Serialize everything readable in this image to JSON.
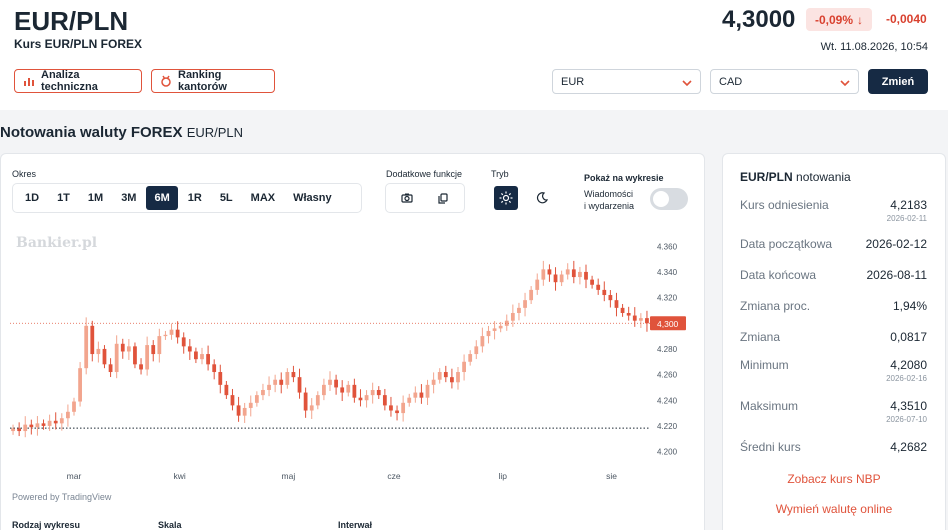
{
  "header": {
    "title": "EUR/PLN",
    "subtitle": "Kurs EUR/PLN FOREX",
    "price": "4,3000",
    "change_pct": "-0,09%",
    "change_abs": "-0,0040",
    "timestamp": "Wt. 11.08.2026, 10:54",
    "btn_analiza": "Analiza techniczna",
    "btn_ranking": "Ranking kantorów",
    "currency_from": "EUR",
    "currency_to": "CAD",
    "btn_zmien": "Zmień",
    "accent_color": "#e0533b",
    "negative_color": "#d9412f"
  },
  "section": {
    "title": "Notowania waluty FOREX",
    "subtitle": "EUR/PLN"
  },
  "controls": {
    "okres_label": "Okres",
    "periods": [
      "1D",
      "1T",
      "1M",
      "3M",
      "6M",
      "1R",
      "5L",
      "MAX",
      "Własny"
    ],
    "active_period": "6M",
    "extra_label": "Dodatkowe funkcje",
    "mode_label": "Tryb",
    "show_label": "Pokaż na wykresie",
    "events_label_1": "Wiadomości",
    "events_label_2": "i wydarzenia",
    "powered_by": "Powered by TradingView",
    "bottom_labels": [
      "Rodzaj wykresu",
      "Skala",
      "Interwał"
    ]
  },
  "chart_data": {
    "type": "candlestick",
    "watermark": "Bankier.pl",
    "y_ticks": [
      4.36,
      4.34,
      4.32,
      4.3,
      4.28,
      4.26,
      4.24,
      4.22,
      4.2
    ],
    "y_tick_labels": [
      "4.360",
      "4.340",
      "4.320",
      "4.300",
      "4.280",
      "4.260",
      "4.240",
      "4.220",
      "4.200"
    ],
    "ylim": [
      4.195,
      4.368
    ],
    "x_labels": [
      "mar",
      "kwi",
      "maj",
      "cze",
      "lip",
      "sie"
    ],
    "current_price": 4.3,
    "current_price_label": "4,300",
    "reference_line": 4.2183,
    "up_color": "#f2a58e",
    "down_color": "#e0533b",
    "close_series": [
      4.218,
      4.216,
      4.221,
      4.219,
      4.222,
      4.22,
      4.224,
      4.222,
      4.226,
      4.231,
      4.239,
      4.265,
      4.298,
      4.276,
      4.28,
      4.268,
      4.262,
      4.284,
      4.278,
      4.282,
      4.268,
      4.264,
      4.283,
      4.276,
      4.29,
      4.291,
      4.295,
      4.289,
      4.282,
      4.278,
      4.272,
      4.276,
      4.268,
      4.262,
      4.252,
      4.244,
      4.236,
      4.228,
      4.234,
      4.238,
      4.244,
      4.248,
      4.252,
      4.256,
      4.252,
      4.262,
      4.258,
      4.246,
      4.232,
      4.236,
      4.244,
      4.252,
      4.256,
      4.25,
      4.246,
      4.252,
      4.242,
      4.24,
      4.244,
      4.248,
      4.244,
      4.236,
      4.232,
      4.23,
      4.238,
      4.242,
      4.246,
      4.242,
      4.252,
      4.256,
      4.262,
      4.258,
      4.254,
      4.262,
      4.27,
      4.276,
      4.282,
      4.29,
      4.294,
      4.296,
      4.298,
      4.302,
      4.308,
      4.312,
      4.318,
      4.326,
      4.334,
      4.342,
      4.338,
      4.332,
      4.338,
      4.342,
      4.336,
      4.34,
      4.334,
      4.33,
      4.326,
      4.322,
      4.318,
      4.312,
      4.308,
      4.306,
      4.302,
      4.304,
      4.3
    ]
  },
  "stats": {
    "title_pair": "EUR/PLN",
    "title_rest": "notowania",
    "rows": [
      {
        "label": "Kurs odniesienia",
        "value": "4,2183",
        "date": "2026-02-11"
      },
      {
        "label": "Data początkowa",
        "value": "2026-02-12"
      },
      {
        "label": "Data końcowa",
        "value": "2026-08-11"
      },
      {
        "label": "Zmiana proc.",
        "value": "1,94%"
      },
      {
        "label": "Zmiana",
        "value": "0,0817"
      },
      {
        "label": "Minimum",
        "value": "4,2080",
        "date": "2026-02-16"
      },
      {
        "label": "Maksimum",
        "value": "4,3510",
        "date": "2026-07-10"
      },
      {
        "label": "Średni kurs",
        "value": "4,2682"
      }
    ],
    "link_nbp": "Zobacz kurs NBP",
    "link_exchange": "Wymień walutę online"
  }
}
